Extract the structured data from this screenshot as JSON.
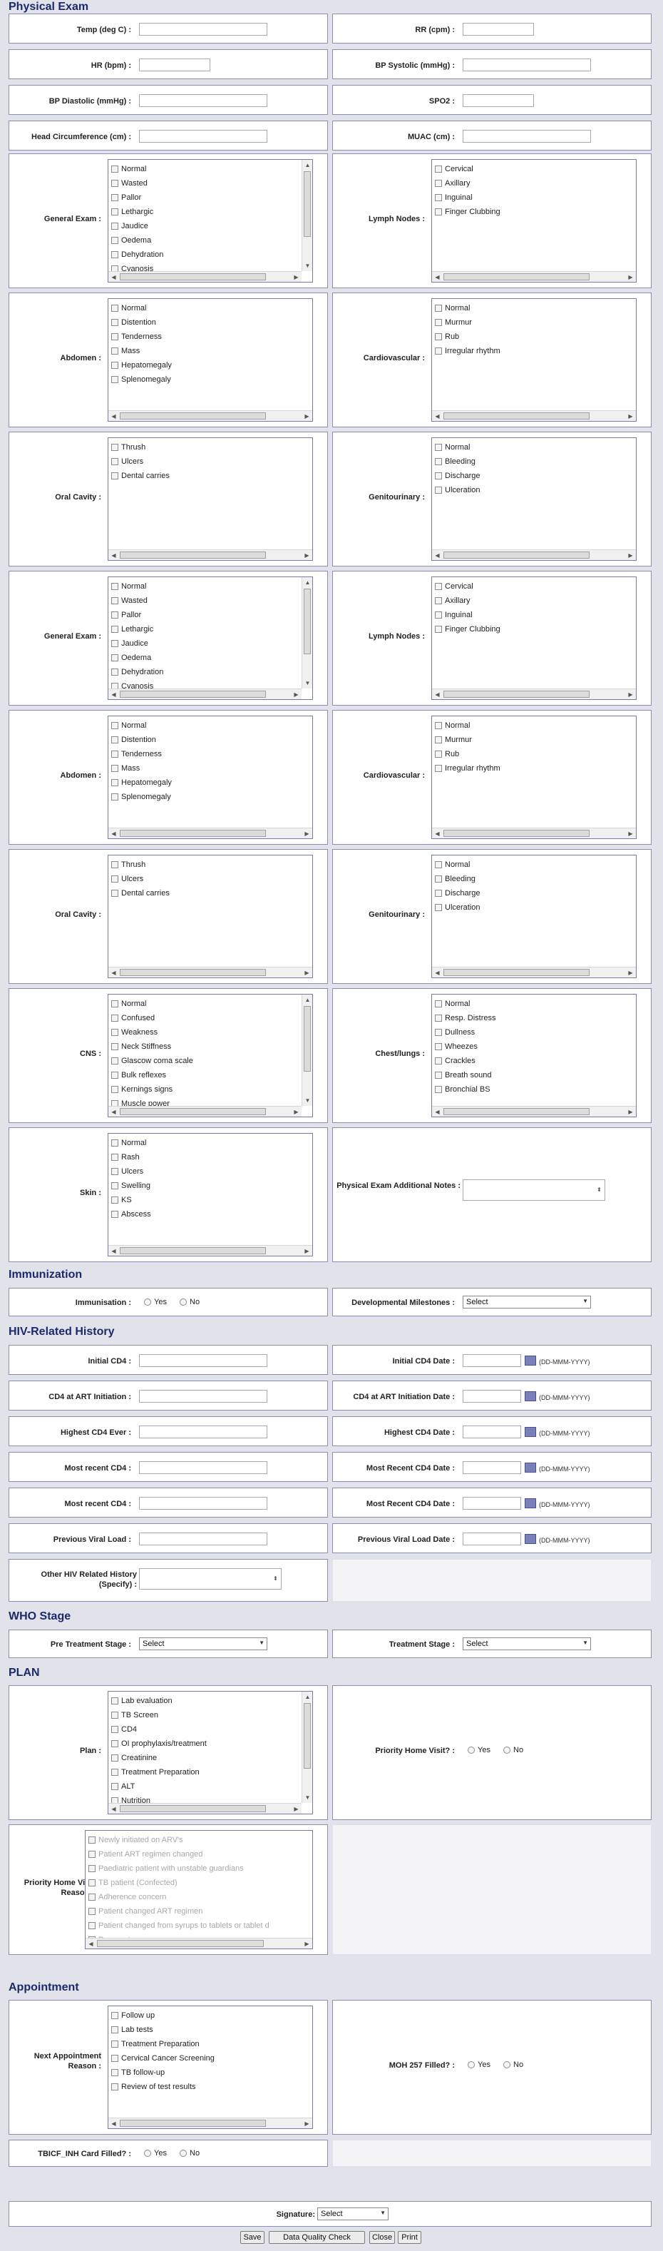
{
  "sections": {
    "physical_exam": "Physical Exam",
    "immunization": "Immunization",
    "hiv": "HIV-Related History",
    "who": "WHO Stage",
    "plan": "PLAN",
    "appointment": "Appointment"
  },
  "physical_exam": {
    "temp": "Temp (deg C) :",
    "rr": "RR (cpm) :",
    "hr": "HR (bpm) :",
    "bp_systolic": "BP Systolic (mmHg) :",
    "bp_diastolic": "BP Diastolic (mmHg) :",
    "spo2": "SPO2 :",
    "head_circ": "Head Circumference (cm) :",
    "muac": "MUAC (cm) :",
    "general_exam": {
      "label": "General Exam :",
      "options": [
        "Normal",
        "Wasted",
        "Pallor",
        "Lethargic",
        "Jaudice",
        "Oedema",
        "Dehydration",
        "Cyanosis"
      ]
    },
    "lymph_nodes": {
      "label": "Lymph Nodes :",
      "options": [
        "Cervical",
        "Axillary",
        "Inguinal",
        "Finger Clubbing"
      ]
    },
    "abdomen": {
      "label": "Abdomen :",
      "options": [
        "Normal",
        "Distention",
        "Tenderness",
        "Mass",
        "Hepatomegaly",
        "Splenomegaly"
      ]
    },
    "cardiovascular": {
      "label": "Cardiovascular :",
      "options": [
        "Normal",
        "Murmur",
        "Rub",
        "Irregular rhythm"
      ]
    },
    "oral_cavity": {
      "label": "Oral Cavity :",
      "options": [
        "Thrush",
        "Ulcers",
        "Dental carries"
      ]
    },
    "genitourinary": {
      "label": "Genitourinary :",
      "options": [
        "Normal",
        "Bleeding",
        "Discharge",
        "Ulceration"
      ]
    },
    "cns": {
      "label": "CNS :",
      "options": [
        "Normal",
        "Confused",
        "Weakness",
        "Neck Stiffness",
        "Glascow coma scale",
        "Bulk reflexes",
        "Kernings signs",
        "Muscle power"
      ]
    },
    "chest": {
      "label": "Chest/lungs :",
      "options": [
        "Normal",
        "Resp. Distress",
        "Dullness",
        "Wheezes",
        "Crackles",
        "Breath sound",
        "Bronchial BS"
      ]
    },
    "skin": {
      "label": "Skin :",
      "options": [
        "Normal",
        "Rash",
        "Ulcers",
        "Swelling",
        "KS",
        "Abscess"
      ]
    },
    "additional_notes": "Physical Exam Additional Notes :"
  },
  "immunization": {
    "immunisation": "Immunisation :",
    "yes": "Yes",
    "no": "No",
    "milestones": "Developmental Milestones :",
    "milestones_value": "Select"
  },
  "hiv": {
    "initial_cd4": "Initial CD4 :",
    "initial_cd4_date": "Initial CD4 Date :",
    "cd4_art": "CD4 at ART Initiation :",
    "cd4_art_date": "CD4 at ART Initiation Date :",
    "highest_cd4": "Highest CD4 Ever :",
    "highest_cd4_date": "Highest CD4 Date :",
    "recent_cd4_1": "Most recent CD4 :",
    "recent_cd4_date_1": "Most Recent CD4 Date :",
    "recent_cd4_2": "Most recent CD4 :",
    "recent_cd4_date_2": "Most Recent CD4 Date :",
    "prev_vl": "Previous Viral Load :",
    "prev_vl_date": "Previous Viral Load Date :",
    "other": "Other HIV Related History (Specify) :",
    "date_format": "(DD-MMM-YYYY)"
  },
  "who": {
    "pre_treatment": "Pre Treatment Stage :",
    "pre_treatment_value": "Select",
    "treatment": "Treatment Stage :",
    "treatment_value": "Select"
  },
  "plan": {
    "plan": {
      "label": "Plan :",
      "options": [
        "Lab evaluation",
        "TB Screen",
        "CD4",
        "OI prophylaxis/treatment",
        "Creatinine",
        "Treatment Preparation",
        "ALT",
        "Nutrition"
      ]
    },
    "priority_visit": "Priority Home Visit? :",
    "yes": "Yes",
    "no": "No",
    "reason": {
      "label": "Priority Home Visit Reason :",
      "options": [
        "Newly initiated on ARV's",
        "Patient ART regimen changed",
        "Paediatric patient with unstable guardians",
        "TB patient (Confected)",
        "Adherence concern",
        "Patient changed ART regimen",
        "Patient changed from syrups to tablets or tablet d",
        "Pregnant woman"
      ]
    }
  },
  "appointment": {
    "reason": {
      "label": "Next Appointment Reason :",
      "options": [
        "Follow up",
        "Lab tests",
        "Treatment Preparation",
        "Cervical Cancer Screening",
        "TB follow-up",
        "Review of test results"
      ]
    },
    "moh": "MOH 257 Filled? :",
    "yes": "Yes",
    "no": "No",
    "tbicf": "TBICF_INH Card Filled? :"
  },
  "footer": {
    "signature": "Signature:",
    "signature_value": "Select",
    "save": "Save",
    "dq_check": "Data Quality Check",
    "close": "Close",
    "print": "Print"
  }
}
